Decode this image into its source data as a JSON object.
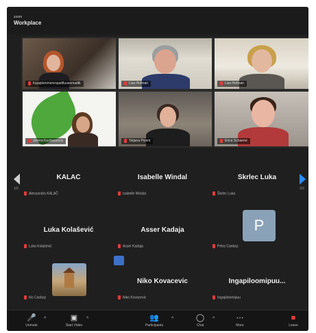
{
  "window": {
    "small": "zoom",
    "title": "Workplace"
  },
  "gallery": [
    {
      "label": "Ingaplommerenpadiluusomadik"
    },
    {
      "label": "Lisa Hofman"
    },
    {
      "label": "Lisa Hofman"
    },
    {
      "label": "Jelena Kuzbassovic"
    },
    {
      "label": "Tatjana Pizent"
    },
    {
      "label": "Erica Schaerer"
    }
  ],
  "nav": {
    "left_page": "1/2",
    "right_page": "2/2"
  },
  "participants": [
    {
      "name": "KALAČ",
      "label": "Alessandro KALAČ"
    },
    {
      "name": "Isabelle Windal",
      "label": "Isabelle Windal"
    },
    {
      "name": "Škrlec Luka",
      "label": "Škrlec Luka"
    },
    {
      "name": "Luka Kolašević",
      "label": "Luka Kolašević"
    },
    {
      "name": "Asser Kadaja",
      "label": "Asser Kadaja"
    },
    {
      "name": "",
      "label": "Petra Canbaz"
    },
    {
      "name": "",
      "label": "Iris Canbaz"
    },
    {
      "name": "Niko Kovacevic",
      "label": "Niko Kovacevic"
    },
    {
      "name": "Ingapiloomipuu...",
      "label": "Ingapiloomipuu"
    }
  ],
  "avatar_letter": "P",
  "toolbar": [
    {
      "icon": "mic-icon",
      "label": "Unmute"
    },
    {
      "icon": "video-icon",
      "label": "Start Video"
    },
    {
      "icon": "participants-icon",
      "label": "Participants"
    },
    {
      "icon": "chat-icon",
      "label": "Chat"
    },
    {
      "icon": "more-icon",
      "label": "More"
    },
    {
      "icon": "leave-icon",
      "label": "Leave"
    }
  ],
  "colors": {
    "bg": "#1f1f1f",
    "accent": "#2d8cff",
    "muted": "#e23b3b"
  }
}
